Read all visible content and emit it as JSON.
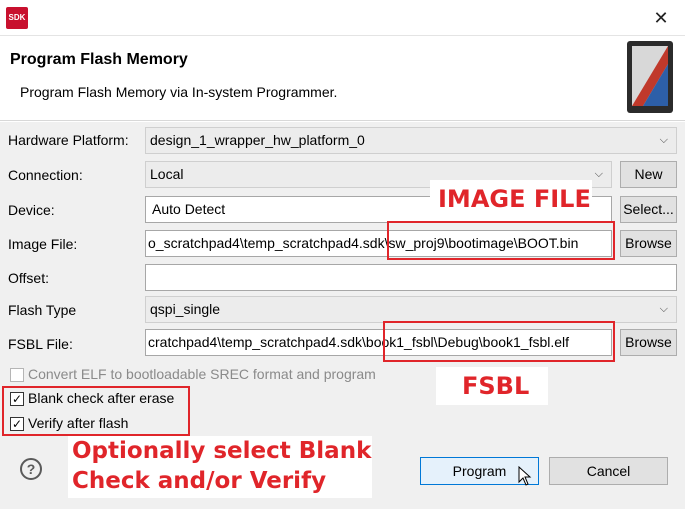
{
  "window": {
    "logo_text": "SDK",
    "close_glyph": "✕"
  },
  "header": {
    "title": "Program Flash Memory",
    "subtitle": "Program Flash Memory via In-system Programmer."
  },
  "form": {
    "hardware_platform": {
      "label": "Hardware Platform:",
      "value": "design_1_wrapper_hw_platform_0"
    },
    "connection": {
      "label": "Connection:",
      "value": "Local",
      "button": "New"
    },
    "device": {
      "label": "Device:",
      "value": "Auto Detect",
      "button": "Select..."
    },
    "image_file": {
      "label": "Image File:",
      "value": "o_scratchpad4\\temp_scratchpad4.sdk\\sw_proj9\\bootimage\\BOOT.bin",
      "button": "Browse"
    },
    "offset": {
      "label": "Offset:",
      "value": ""
    },
    "flash_type": {
      "label": "Flash Type",
      "value": "qspi_single"
    },
    "fsbl_file": {
      "label": "FSBL File:",
      "value": "cratchpad4\\temp_scratchpad4.sdk\\book1_fsbl\\Debug\\book1_fsbl.elf",
      "button": "Browse"
    }
  },
  "options": {
    "convert_elf": {
      "label": "Convert ELF to bootloadable SREC format and program",
      "checked": false,
      "enabled": false
    },
    "blank_check": {
      "label": "Blank check after erase",
      "checked": true
    },
    "verify": {
      "label": "Verify after flash",
      "checked": true
    },
    "check_glyph": "✓"
  },
  "annotations": {
    "image_file": "IMAGE FILE",
    "fsbl": "FSBL",
    "optional_line1": "Optionally select Blank",
    "optional_line2": "Check and/or Verify",
    "color": "#e0252a"
  },
  "footer": {
    "help_glyph": "?",
    "program_label": "Program",
    "cancel_label": "Cancel"
  },
  "icons": {
    "dropdown": "chevron-down-icon",
    "help": "help-icon",
    "cursor": "mouse-pointer-icon"
  }
}
